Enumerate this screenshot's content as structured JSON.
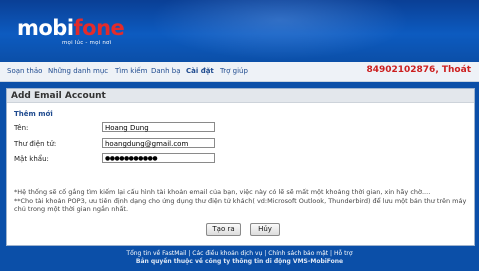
{
  "brand": {
    "logo_main": "mobi",
    "logo_accent": "fone",
    "tagline": "mọi lúc - mọi nơi"
  },
  "nav": {
    "items": [
      "Soạn thảo",
      "Những danh mục",
      "Tìm kiếm",
      "Danh bạ",
      "Cài đặt",
      "Trợ giúp"
    ],
    "active": "Cài đặt",
    "phone": "84902102876",
    "separator": ",",
    "logout": "Thoát"
  },
  "panel": {
    "title": "Add Email Account",
    "section": "Thêm mới",
    "fields": {
      "name_label": "Tên:",
      "name_value": "Hoang Dung",
      "email_label": "Thư điện tử:",
      "email_value": "hoangdung@gmail.com",
      "password_label": "Mật khẩu:",
      "password_value": "●●●●●●●●●●●"
    },
    "note1": "*Hệ thống sẽ cố gắng tìm kiếm lại cấu hình tài khoản email của bạn, việc này có lẽ sẽ mất một khoảng thời gian, xin hãy chờ....",
    "note2": "**Cho tài khoản POP3, ưu tiên định dạng cho ứng dụng thư điện tử khách( vd:Microsoft Outlook, Thunderbird) để lưu một bản thư trên máy chủ trong một thời gian ngắn nhất.",
    "create_button": "Tạo ra",
    "cancel_button": "Hủy"
  },
  "footer": {
    "links": [
      "Tổng tin về FastMail",
      "Các điều khoản dịch vụ",
      "Chính sách bảo mật",
      "Hỗ trợ"
    ],
    "link_separator": " | ",
    "copyright": "Bản quyền thuộc về công ty thông tin di động VMS-MobiFone"
  }
}
